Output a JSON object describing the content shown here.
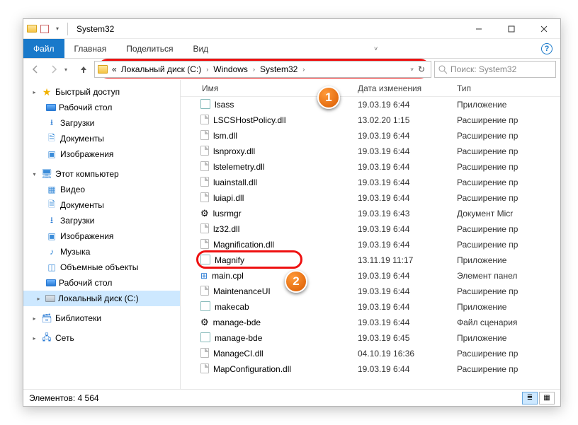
{
  "window": {
    "title": "System32",
    "controls": {
      "min": "—",
      "max": "▢",
      "close": "✕"
    }
  },
  "ribbon": {
    "file": "Файл",
    "tabs": [
      "Главная",
      "Поделиться",
      "Вид"
    ],
    "help": "?"
  },
  "address": {
    "segments": [
      "«",
      "Локальный диск (C:)",
      "Windows",
      "System32"
    ],
    "refresh_dd": "˅",
    "refresh": "↻"
  },
  "search": {
    "placeholder": "Поиск: System32"
  },
  "sidebar": {
    "quick": {
      "label": "Быстрый доступ",
      "items": [
        {
          "icon": "desktop",
          "label": "Рабочий стол"
        },
        {
          "icon": "download",
          "label": "Загрузки"
        },
        {
          "icon": "doc",
          "label": "Документы"
        },
        {
          "icon": "pic",
          "label": "Изображения"
        }
      ]
    },
    "pc": {
      "label": "Этот компьютер",
      "items": [
        {
          "icon": "video",
          "label": "Видео"
        },
        {
          "icon": "doc",
          "label": "Документы"
        },
        {
          "icon": "download",
          "label": "Загрузки"
        },
        {
          "icon": "pic",
          "label": "Изображения"
        },
        {
          "icon": "music",
          "label": "Музыка"
        },
        {
          "icon": "3d",
          "label": "Объемные объекты"
        },
        {
          "icon": "desktop",
          "label": "Рабочий стол"
        },
        {
          "icon": "disk",
          "label": "Локальный диск (C:)",
          "selected": true
        }
      ]
    },
    "libs": {
      "label": "Библиотеки"
    },
    "net": {
      "label": "Сеть"
    }
  },
  "columns": {
    "name": "Имя",
    "date": "Дата изменения",
    "type": "Тип"
  },
  "files": [
    {
      "icon": "app",
      "name": "lsass",
      "date": "19.03.19 6:44",
      "type": "Приложение"
    },
    {
      "icon": "file",
      "name": "LSCSHostPolicy.dll",
      "date": "13.02.20 1:15",
      "type": "Расширение пр"
    },
    {
      "icon": "file",
      "name": "lsm.dll",
      "date": "19.03.19 6:44",
      "type": "Расширение пр"
    },
    {
      "icon": "file",
      "name": "lsnproxy.dll",
      "date": "19.03.19 6:44",
      "type": "Расширение пр"
    },
    {
      "icon": "file",
      "name": "lstelemetry.dll",
      "date": "19.03.19 6:44",
      "type": "Расширение пр"
    },
    {
      "icon": "file",
      "name": "luainstall.dll",
      "date": "19.03.19 6:44",
      "type": "Расширение пр"
    },
    {
      "icon": "file",
      "name": "luiapi.dll",
      "date": "19.03.19 6:44",
      "type": "Расширение пр"
    },
    {
      "icon": "gear",
      "name": "lusrmgr",
      "date": "19.03.19 6:43",
      "type": "Документ Micr"
    },
    {
      "icon": "file",
      "name": "lz32.dll",
      "date": "19.03.19 6:44",
      "type": "Расширение пр"
    },
    {
      "icon": "file",
      "name": "Magnification.dll",
      "date": "19.03.19 6:44",
      "type": "Расширение пр"
    },
    {
      "icon": "app",
      "name": "Magnify",
      "date": "13.11.19 11:17",
      "type": "Приложение",
      "highlighted": true
    },
    {
      "icon": "cpl",
      "name": "main.cpl",
      "date": "19.03.19 6:44",
      "type": "Элемент панел"
    },
    {
      "icon": "file",
      "name": "MaintenanceUI",
      "date": "19.03.19 6:44",
      "type": "Расширение пр"
    },
    {
      "icon": "app",
      "name": "makecab",
      "date": "19.03.19 6:44",
      "type": "Приложение"
    },
    {
      "icon": "bat",
      "name": "manage-bde",
      "date": "19.03.19 6:44",
      "type": "Файл сценария"
    },
    {
      "icon": "app",
      "name": "manage-bde",
      "date": "19.03.19 6:45",
      "type": "Приложение"
    },
    {
      "icon": "file",
      "name": "ManageCI.dll",
      "date": "04.10.19 16:36",
      "type": "Расширение пр"
    },
    {
      "icon": "file",
      "name": "MapConfiguration.dll",
      "date": "19.03.19 6:44",
      "type": "Расширение пр"
    }
  ],
  "status": {
    "label": "Элементов:",
    "count": "4 564"
  },
  "callouts": {
    "c1": "1",
    "c2": "2"
  }
}
